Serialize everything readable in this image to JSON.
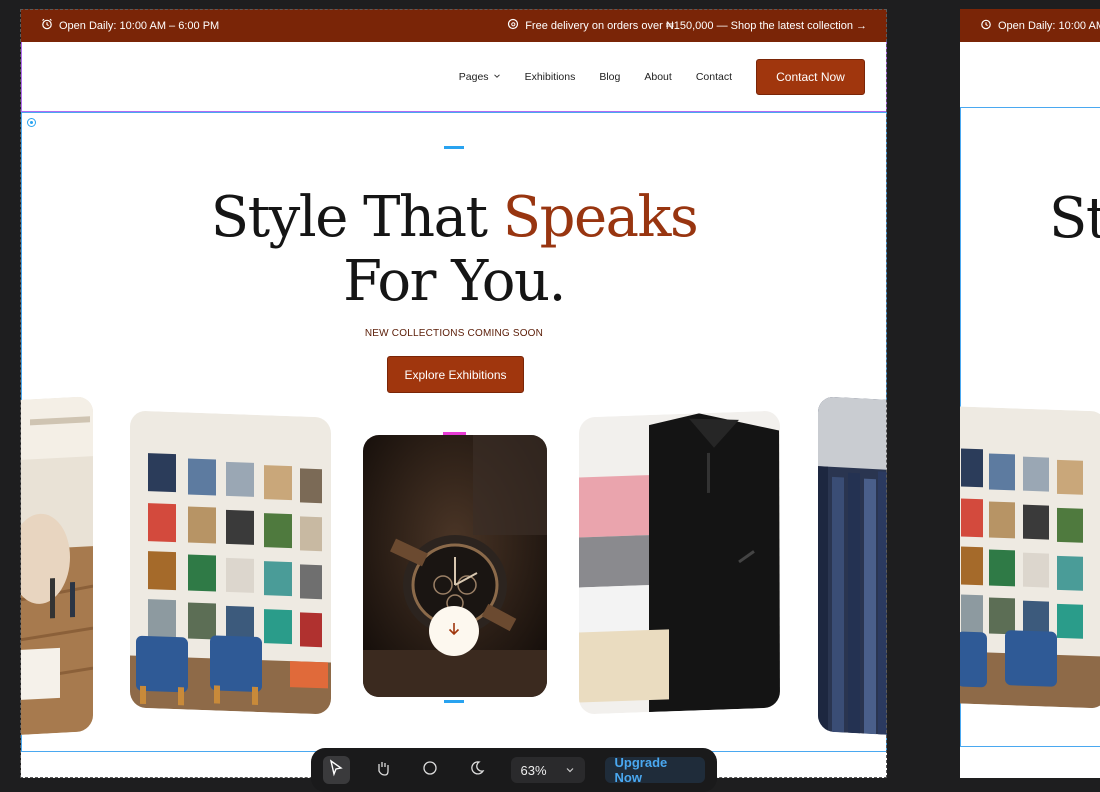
{
  "top_bar": {
    "hours": "Open Daily: 10:00 AM – 6:00 PM",
    "promo": "Free delivery on orders over ₦150,000 — Shop the latest collection →"
  },
  "nav": {
    "items": [
      {
        "label": "Pages"
      },
      {
        "label": "Exhibitions"
      },
      {
        "label": "Blog"
      },
      {
        "label": "About"
      },
      {
        "label": "Contact"
      }
    ],
    "cta": "Contact Now"
  },
  "hero": {
    "title_part1": "Style That ",
    "title_accent": "Speaks",
    "title_line2": "For You.",
    "subtitle": "NEW COLLECTIONS COMING SOON",
    "cta": "Explore Exhibitions"
  },
  "side_preview": {
    "hours": "Open Daily: 10:00 AM",
    "title_fragment": "Sty"
  },
  "toolbar": {
    "zoom": "63%",
    "upgrade": "Upgrade Now"
  },
  "colors": {
    "brand": "#7a2507",
    "accent": "#983510",
    "selection": "#29a3f0",
    "component_outline": "#b16cf0",
    "handle_pink": "#e83bd5"
  },
  "icons": {
    "hours": "alarm-clock-icon",
    "promo": "threads-icon",
    "pages_dropdown": "chevron-down-icon",
    "scroll": "arrow-down-icon",
    "tools": [
      "pointer-icon",
      "hand-icon",
      "comment-icon",
      "moon-icon"
    ]
  }
}
